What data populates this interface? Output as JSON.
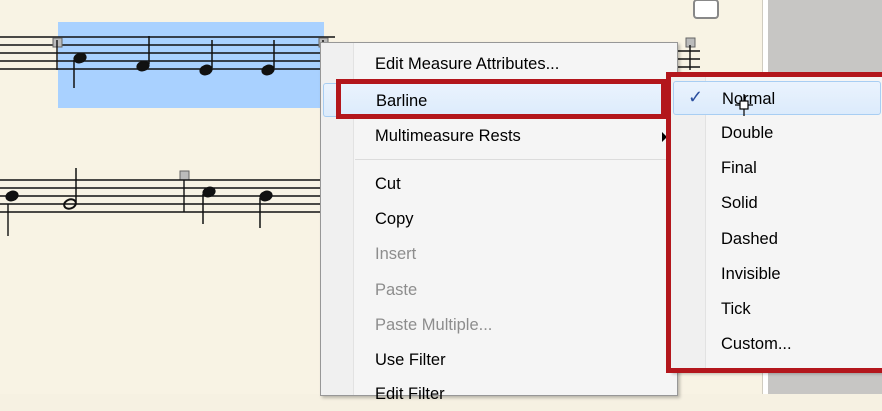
{
  "context_menu": {
    "items": [
      {
        "label": "Edit Measure Attributes...",
        "enabled": true
      },
      {
        "label": "Barline",
        "enabled": true,
        "submenu": true,
        "highlighted": true
      },
      {
        "label": "Multimeasure Rests",
        "enabled": true,
        "submenu": true
      },
      {
        "label": "Cut",
        "enabled": true
      },
      {
        "label": "Copy",
        "enabled": true
      },
      {
        "label": "Insert",
        "enabled": false
      },
      {
        "label": "Paste",
        "enabled": false
      },
      {
        "label": "Paste Multiple...",
        "enabled": false
      },
      {
        "label": "Use Filter",
        "enabled": true
      },
      {
        "label": "Edit Filter",
        "enabled": true
      }
    ]
  },
  "barline_submenu": {
    "items": [
      {
        "label": "Normal",
        "checked": true
      },
      {
        "label": "Double"
      },
      {
        "label": "Final"
      },
      {
        "label": "Solid"
      },
      {
        "label": "Dashed"
      },
      {
        "label": "Invisible"
      },
      {
        "label": "Tick"
      },
      {
        "label": "Custom..."
      }
    ],
    "check_glyph": "✓"
  },
  "colors": {
    "selection": "#a9d1ff",
    "highlight_box": "#b3161c",
    "paper": "#f8f3e4"
  }
}
